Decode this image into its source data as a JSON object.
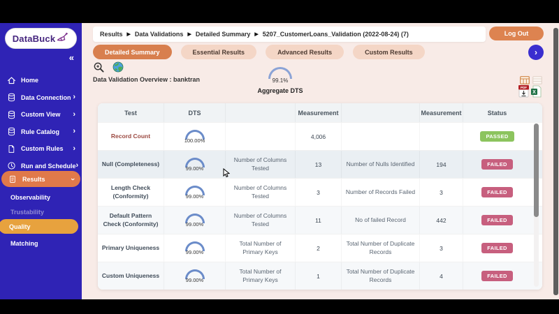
{
  "sidebar": {
    "logo_text": "DataBuck",
    "collapse_icon": "«",
    "chevron_char": "›",
    "items": [
      {
        "label": "Home",
        "icon": "home-icon",
        "has_chevron": false
      },
      {
        "label": "Data Connection",
        "icon": "database-icon",
        "has_chevron": true
      },
      {
        "label": "Custom View",
        "icon": "database-icon",
        "has_chevron": true
      },
      {
        "label": "Rule Catalog",
        "icon": "database-icon",
        "has_chevron": true
      },
      {
        "label": "Custom Rules",
        "icon": "file-icon",
        "has_chevron": true
      },
      {
        "label": "Run and Schedule",
        "icon": "clock-icon",
        "has_chevron": true
      }
    ],
    "results_item": {
      "label": "Results",
      "icon": "clipboard-icon"
    },
    "sub_items": [
      {
        "label": "Observability"
      },
      {
        "label": "Trustability"
      },
      {
        "label": "Quality"
      },
      {
        "label": "Matching"
      }
    ]
  },
  "header": {
    "breadcrumb_parts": [
      "Results",
      "Data Validations",
      "Detailed Summary",
      "5207_CustomerLoans_Validation (2022-08-24) (7)"
    ],
    "breadcrumb_separator": "▶",
    "logout_label": "Log Out",
    "next_button": "›"
  },
  "tabs": [
    {
      "label": "Detailed Summary",
      "active": true
    },
    {
      "label": "Essential Results",
      "active": false
    },
    {
      "label": "Advanced Results",
      "active": false
    },
    {
      "label": "Custom Results",
      "active": false
    }
  ],
  "overview": {
    "label": "Data Validation Overview : banktran",
    "aggregate_gauge": {
      "value": "99.1%",
      "label": "Aggregate DTS"
    }
  },
  "table": {
    "columns": [
      "Test",
      "DTS",
      "",
      "Measurement",
      "",
      "Measurement",
      "Status"
    ],
    "rows": [
      {
        "test": "Record Count",
        "dts": "100.00%",
        "m1_label": "",
        "m1": "4,006",
        "m2_label": "",
        "m2": "",
        "status": "PASSED"
      },
      {
        "test": "Null (Completeness)",
        "dts": "99.00%",
        "m1_label": "Number of Columns Tested",
        "m1": "13",
        "m2_label": "Number of Nulls Identified",
        "m2": "194",
        "status": "FAILED"
      },
      {
        "test": "Length Check (Conformity)",
        "dts": "99.00%",
        "m1_label": "Number of Columns Tested",
        "m1": "3",
        "m2_label": "Number of Records Failed",
        "m2": "3",
        "status": "FAILED"
      },
      {
        "test": "Default Pattern Check (Conformity)",
        "dts": "99.00%",
        "m1_label": "Number of Columns Tested",
        "m1": "11",
        "m2_label": "No of failed Record",
        "m2": "442",
        "status": "FAILED"
      },
      {
        "test": "Primary Uniqueness",
        "dts": "99.00%",
        "m1_label": "Total Number of Primary Keys",
        "m1": "2",
        "m2_label": "Total Number of Duplicate Records",
        "m2": "3",
        "status": "FAILED"
      },
      {
        "test": "Custom Uniqueness",
        "dts": "99.00%",
        "m1_label": "Total Number of Primary Keys",
        "m1": "1",
        "m2_label": "Total Number of Duplicate Records",
        "m2": "4",
        "status": "FAILED"
      }
    ]
  },
  "colors": {
    "sidebar_bg": "#2f23b5",
    "accent_orange": "#e0794a",
    "quality_amber": "#e7a23e",
    "passed_green": "#8cc45e",
    "failed_rose": "#c75f7e",
    "main_bg": "#f8ebe7",
    "gauge_blue": "#6b8cc9"
  }
}
